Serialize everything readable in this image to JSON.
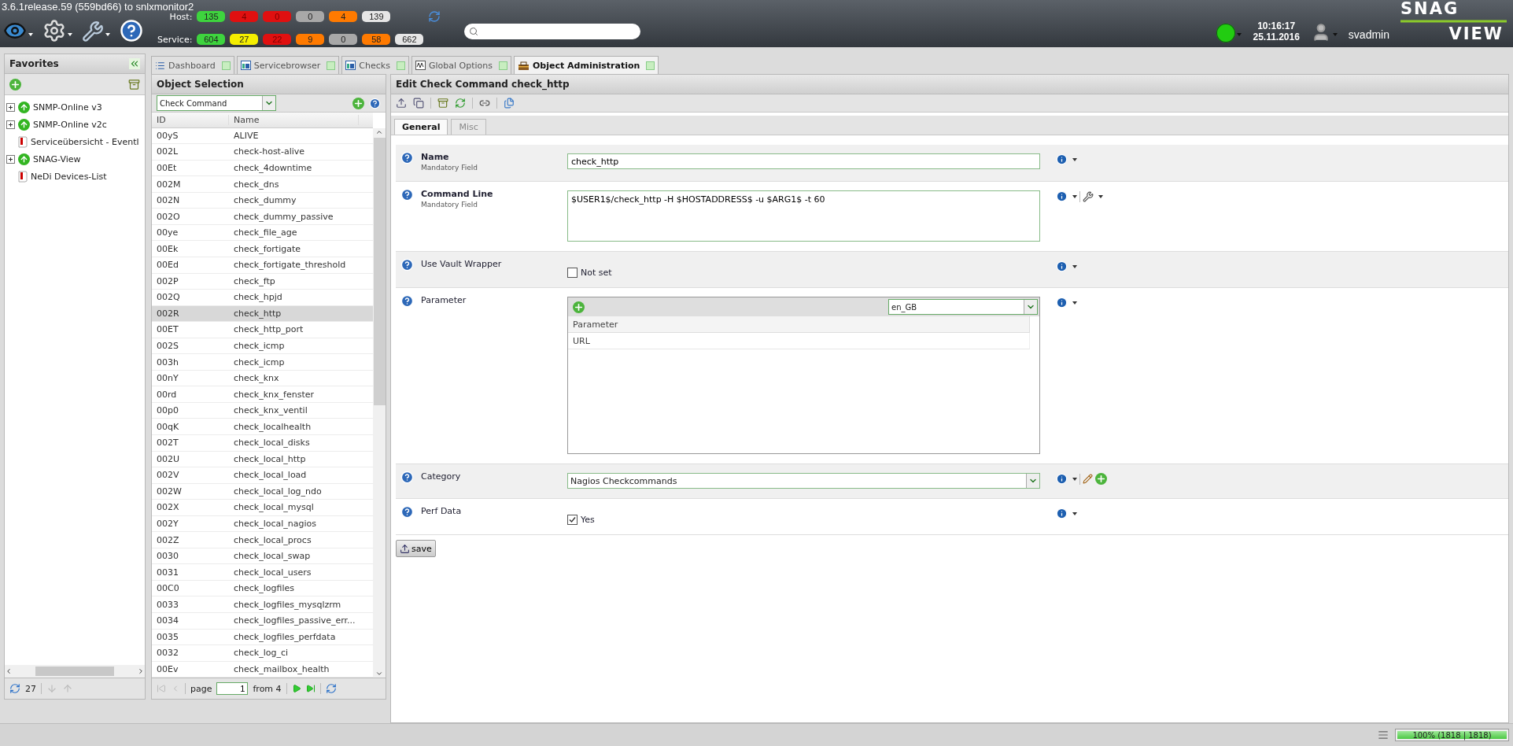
{
  "top_bar": {
    "version": "3.6.1release.59 (559bd66) to snlxmonitor2",
    "host": {
      "label": "Host:",
      "badges": [
        {
          "value": "135",
          "color": "#3ed43e"
        },
        {
          "value": "4",
          "color": "#e01010"
        },
        {
          "value": "0",
          "color": "#e01010"
        },
        {
          "value": "0",
          "color": "#a8a8a8"
        },
        {
          "value": "4",
          "color": "#ff7a00"
        },
        {
          "value": "139",
          "color": "#e6e6e6"
        }
      ]
    },
    "service": {
      "label": "Service:",
      "badges": [
        {
          "value": "604",
          "color": "#3ed43e"
        },
        {
          "value": "27",
          "color": "#f5ee00"
        },
        {
          "value": "22",
          "color": "#e01010"
        },
        {
          "value": "9",
          "color": "#ff7a00"
        },
        {
          "value": "0",
          "color": "#a8a8a8"
        },
        {
          "value": "58",
          "color": "#ff7a00"
        },
        {
          "value": "662",
          "color": "#e6e6e6"
        }
      ]
    },
    "status_ok": true,
    "time": "10:16:17",
    "date": "25.11.2016",
    "user": "svadmin",
    "logo": [
      "SNAG",
      "VIEW"
    ]
  },
  "favorites": {
    "title": "Favorites",
    "items": [
      {
        "label": "SNMP-Online v3",
        "kind": "group",
        "expanded": false
      },
      {
        "label": "SNMP-Online v2c",
        "kind": "group",
        "expanded": false
      },
      {
        "label": "Serviceübersicht - Eventl",
        "kind": "report"
      },
      {
        "label": "SNAG-View",
        "kind": "group",
        "expanded": false
      },
      {
        "label": "NeDi Devices-List",
        "kind": "report"
      }
    ],
    "count": "27"
  },
  "tabs": [
    {
      "label": "Dashboard",
      "selected": false,
      "kind": "list"
    },
    {
      "label": "Servicebrowser",
      "selected": false,
      "kind": "window"
    },
    {
      "label": "Checks",
      "selected": false,
      "kind": "window"
    },
    {
      "label": "Global Options",
      "selected": false,
      "kind": "wave"
    },
    {
      "label": "Object Administration",
      "selected": true,
      "kind": "toolbox"
    }
  ],
  "object_selection": {
    "title": "Object Selection",
    "type_select": "Check Command",
    "columns": [
      "ID",
      "Name"
    ],
    "rows": [
      {
        "id": "00yS",
        "name": "ALIVE",
        "selected": false
      },
      {
        "id": "002L",
        "name": "check-host-alive",
        "selected": false
      },
      {
        "id": "00Et",
        "name": "check_4downtime",
        "selected": false
      },
      {
        "id": "002M",
        "name": "check_dns",
        "selected": false
      },
      {
        "id": "002N",
        "name": "check_dummy",
        "selected": false
      },
      {
        "id": "002O",
        "name": "check_dummy_passive",
        "selected": false
      },
      {
        "id": "00ye",
        "name": "check_file_age",
        "selected": false
      },
      {
        "id": "00Ek",
        "name": "check_fortigate",
        "selected": false
      },
      {
        "id": "00Ed",
        "name": "check_fortigate_threshold",
        "selected": false
      },
      {
        "id": "002P",
        "name": "check_ftp",
        "selected": false
      },
      {
        "id": "002Q",
        "name": "check_hpjd",
        "selected": false
      },
      {
        "id": "002R",
        "name": "check_http",
        "selected": true
      },
      {
        "id": "00ET",
        "name": "check_http_port",
        "selected": false
      },
      {
        "id": "002S",
        "name": "check_icmp",
        "selected": false
      },
      {
        "id": "003h",
        "name": "check_icmp",
        "selected": false
      },
      {
        "id": "00nY",
        "name": "check_knx",
        "selected": false
      },
      {
        "id": "00rd",
        "name": "check_knx_fenster",
        "selected": false
      },
      {
        "id": "00p0",
        "name": "check_knx_ventil",
        "selected": false
      },
      {
        "id": "00qK",
        "name": "check_localhealth",
        "selected": false
      },
      {
        "id": "002T",
        "name": "check_local_disks",
        "selected": false
      },
      {
        "id": "002U",
        "name": "check_local_http",
        "selected": false
      },
      {
        "id": "002V",
        "name": "check_local_load",
        "selected": false
      },
      {
        "id": "002W",
        "name": "check_local_log_ndo",
        "selected": false
      },
      {
        "id": "002X",
        "name": "check_local_mysql",
        "selected": false
      },
      {
        "id": "002Y",
        "name": "check_local_nagios",
        "selected": false
      },
      {
        "id": "002Z",
        "name": "check_local_procs",
        "selected": false
      },
      {
        "id": "0030",
        "name": "check_local_swap",
        "selected": false
      },
      {
        "id": "0031",
        "name": "check_local_users",
        "selected": false
      },
      {
        "id": "00C0",
        "name": "check_logfiles",
        "selected": false
      },
      {
        "id": "0033",
        "name": "check_logfiles_mysqlzrm",
        "selected": false
      },
      {
        "id": "0034",
        "name": "check_logfiles_passive_err...",
        "selected": false
      },
      {
        "id": "0035",
        "name": "check_logfiles_perfdata",
        "selected": false
      },
      {
        "id": "0032",
        "name": "check_log_ci",
        "selected": false
      },
      {
        "id": "00Ev",
        "name": "check_mailbox_health",
        "selected": false
      }
    ],
    "pager": {
      "label": "page",
      "page": "1",
      "total": "from 4"
    }
  },
  "editor": {
    "title": "Edit Check Command check_http",
    "tabs": [
      {
        "label": "General",
        "selected": true
      },
      {
        "label": "Misc",
        "selected": false
      }
    ],
    "fields": [
      {
        "label": "Name",
        "note": "Mandatory Field",
        "kind": "text",
        "value": "check_http"
      },
      {
        "label": "Command Line",
        "note": "Mandatory Field",
        "kind": "textarea",
        "value": "$USER1$/check_http -H $HOSTADDRESS$ -u $ARG1$ -t 60"
      },
      {
        "label": "Use Vault Wrapper",
        "kind": "checkbox",
        "checked": false,
        "value": "Not set"
      },
      {
        "label": "Parameter",
        "kind": "table",
        "language": "en_GB",
        "column": "Parameter",
        "rows": [
          "URL"
        ]
      },
      {
        "label": "Category",
        "kind": "select",
        "value": "Nagios Checkcommands"
      },
      {
        "label": "Perf Data",
        "kind": "checkbox",
        "checked": true,
        "value": "Yes"
      }
    ],
    "save": "save"
  },
  "status_bar": {
    "progress": "100% (1818 | 1818)",
    "level": 1
  }
}
